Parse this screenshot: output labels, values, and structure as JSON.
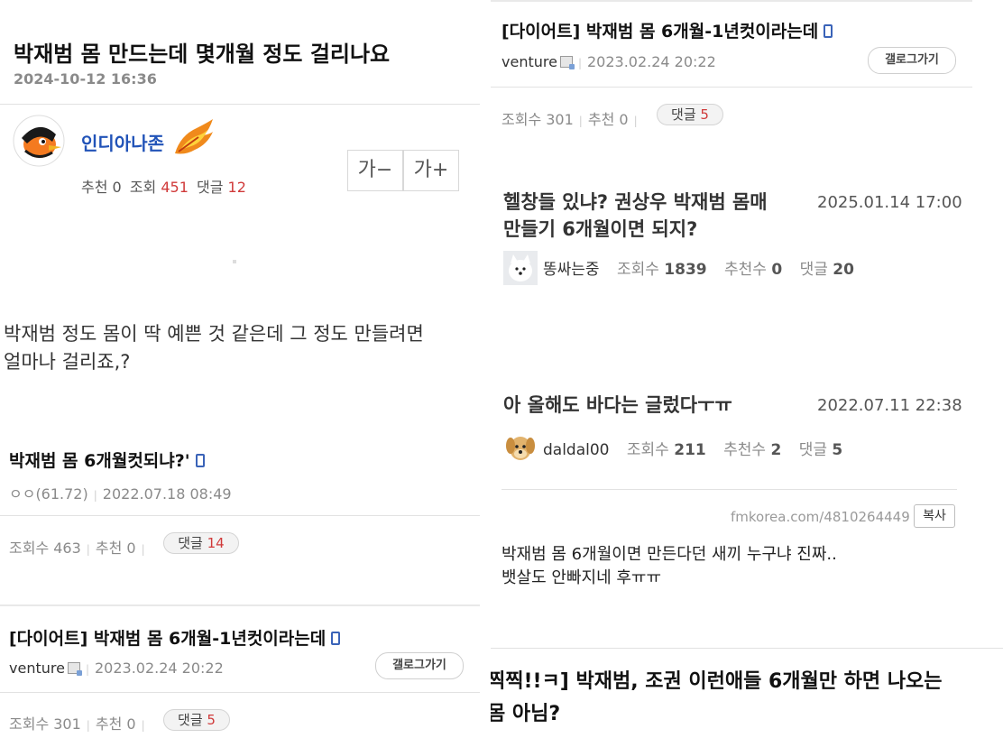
{
  "left": {
    "post": {
      "title": "박재범 몸 만드는데 몇개월 정도 걸리나요",
      "datetime": "2024-10-12 16:36",
      "author": "인디아나존",
      "stats_recommend": "추천 0",
      "stats_view_label": "조회",
      "stats_view_value": "451",
      "stats_comment_label": "댓글",
      "stats_comment_value": "12",
      "font_decrease": "가−",
      "font_increase": "가+",
      "body_line1": "박재범 정도 몸이 딱 예쁜 것 같은데 그 정도 만들려면",
      "body_line2": "얼마나 걸리죠,?"
    },
    "item1": {
      "title": "박재범 몸 6개월컷되냐?'",
      "author": "ㅇㅇ(61.72)",
      "datetime": "2022.07.18 08:49",
      "views": "조회수 463",
      "recommend": "추천 0",
      "comment_label": "댓글",
      "comment_value": "14"
    },
    "item2": {
      "title": "[다이어트] 박재범 몸 6개월-1년컷이라는데",
      "author": "venture",
      "datetime": "2023.02.24 20:22",
      "gallery_button": "갤로그가기",
      "views": "조회수 301",
      "recommend": "추천 0",
      "comment_label": "댓글",
      "comment_value": "5"
    }
  },
  "right": {
    "item2": {
      "title": "[다이어트] 박재범 몸 6개월-1년컷이라는데",
      "author": "venture",
      "datetime": "2023.02.24 20:22",
      "gallery_button": "갤로그가기",
      "views": "조회수 301",
      "recommend": "추천 0",
      "comment_label": "댓글",
      "comment_value": "5"
    },
    "item3": {
      "title_line1": "헬창들 있냐? 권상우 박재범 몸매",
      "title_line2": "만들기 6개월이면 되지?",
      "datetime": "2025.01.14 17:00",
      "author": "똥싸는중",
      "views_label": "조회수",
      "views_value": "1839",
      "recommend_label": "추천수",
      "recommend_value": "0",
      "comment_label": "댓글",
      "comment_value": "20"
    },
    "item4": {
      "title": "아 올해도 바다는 글렀다ㅜㅠ",
      "datetime": "2022.07.11 22:38",
      "author": "daldal00",
      "views_label": "조회수",
      "views_value": "211",
      "recommend_label": "추천수",
      "recommend_value": "2",
      "comment_label": "댓글",
      "comment_value": "5",
      "url": "fmkorea.com/4810264449",
      "copy_button": "복사",
      "body_line1": "박재범 몸 6개월이면 만든다던 새끼 누구냐 진짜..",
      "body_line2": "뱃살도 안빠지네 후ㅠㅠ"
    },
    "item5": {
      "title_line1": "찍찍!!ㅋ] 박재범, 조권 이런애들 6개월만 하면 나오는",
      "title_line2": "몸 아님?"
    }
  }
}
